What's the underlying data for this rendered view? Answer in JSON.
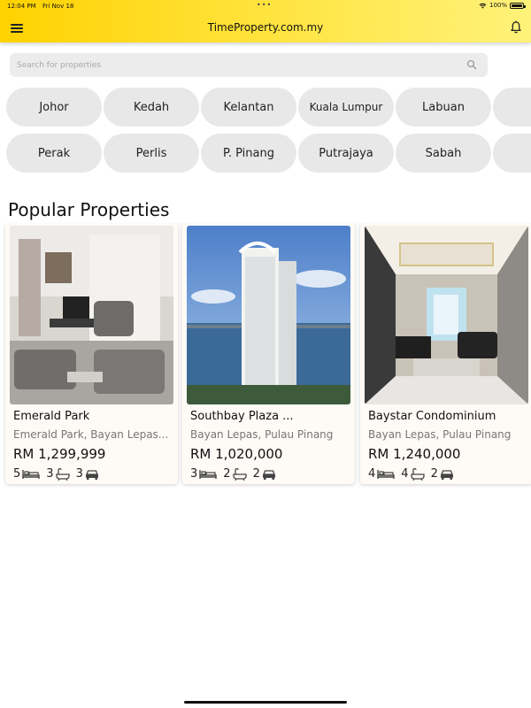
{
  "status_bar": {
    "time": "12:04 PM",
    "date": "Fri Nov 18",
    "battery": "100%"
  },
  "app_bar": {
    "title": "TimeProperty.com.my",
    "menu_icon": "hamburger-menu-icon",
    "bell_icon": "bell-icon"
  },
  "search": {
    "placeholder": "Search for properties",
    "value": ""
  },
  "states_row1": [
    "Johor",
    "Kedah",
    "Kelantan",
    "Kuala Lumpur",
    "Labuan",
    "M"
  ],
  "states_row2": [
    "Perak",
    "Perlis",
    "P. Pinang",
    "Putrajaya",
    "Sabah",
    "S"
  ],
  "section": {
    "title": "Popular Properties"
  },
  "properties": [
    {
      "name": "Emerald Park",
      "location": "Emerald Park, Bayan Lepas...",
      "price": "RM 1,299,999",
      "beds": "5",
      "baths": "3",
      "parking": "3"
    },
    {
      "name": "Southbay Plaza ...",
      "location": "Bayan Lepas, Pulau Pinang",
      "price": "RM 1,020,000",
      "beds": "3",
      "baths": "2",
      "parking": "2"
    },
    {
      "name": "Baystar Condominium",
      "location": "Bayan Lepas, Pulau Pinang",
      "price": "RM 1,240,000",
      "beds": "4",
      "baths": "4",
      "parking": "2"
    }
  ],
  "colors": {
    "app_bar_start": "#ffd200",
    "app_bar_end": "#fff27a",
    "chip_bg": "#e8e8e8",
    "card_bg": "#fefaf6"
  }
}
